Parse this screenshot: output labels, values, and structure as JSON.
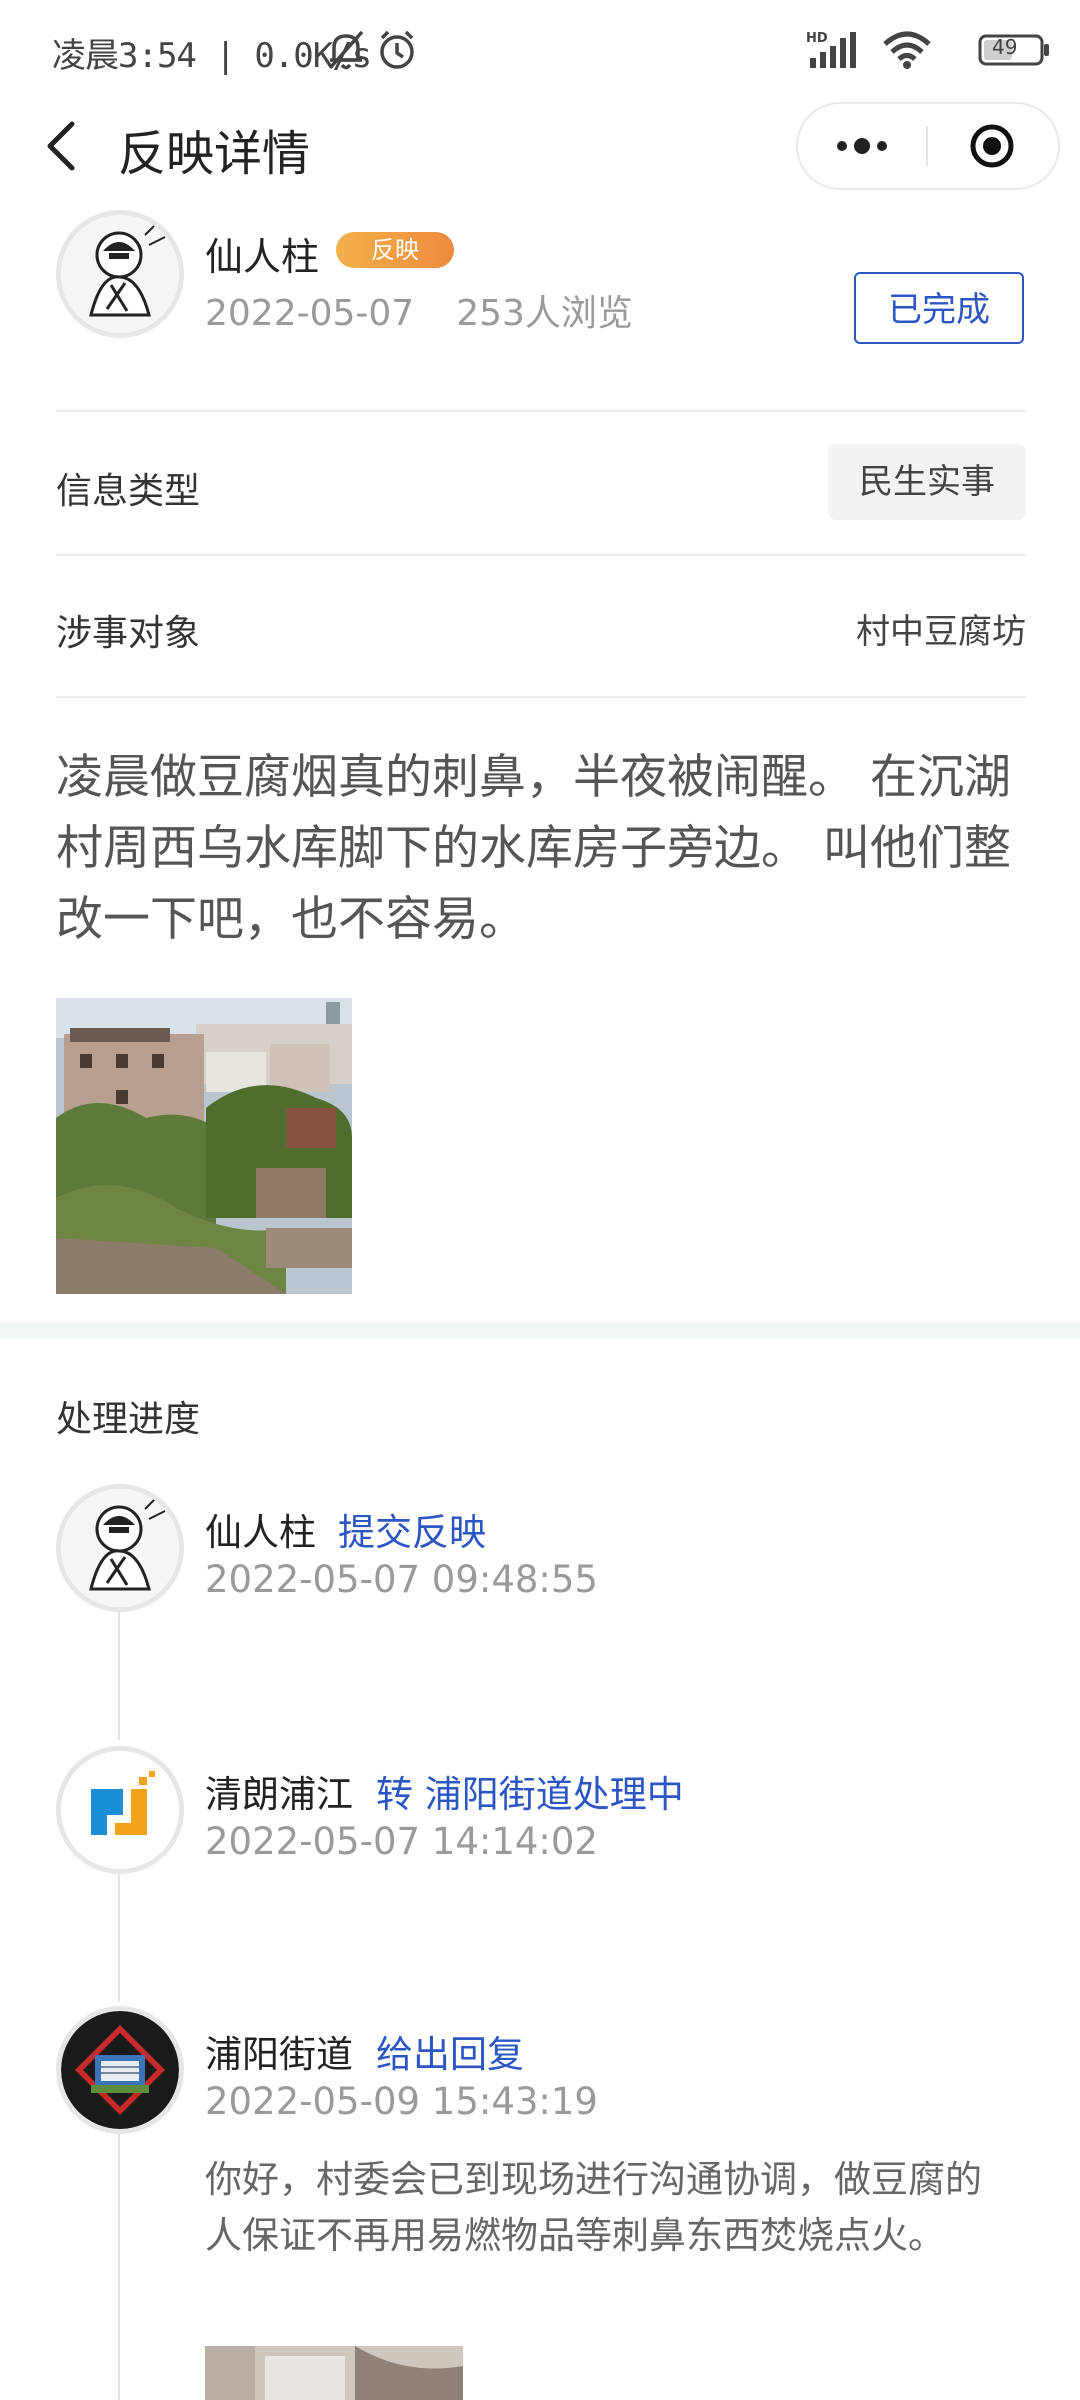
{
  "status_bar": {
    "time": "凌晨3:54",
    "speed": "0.0K/s",
    "battery": "49",
    "hd_label": "HD"
  },
  "titlebar": {
    "title": "反映详情"
  },
  "post": {
    "author": "仙人柱",
    "tag": "反映",
    "date": "2022-05-07",
    "views": "253人浏览",
    "status": "已完成",
    "info_type_label": "信息类型",
    "info_type_value": "民生实事",
    "subject_label": "涉事对象",
    "subject_value": "村中豆腐坊",
    "content": "凌晨做豆腐烟真的刺鼻，半夜被闹醒。 在沉湖村周西乌水库脚下的水库房子旁边。 叫他们整改一下吧，也不容易。"
  },
  "progress": {
    "title": "处理进度",
    "entries": [
      {
        "name": "仙人柱",
        "action": "提交反映",
        "time": "2022-05-07 09:48:55"
      },
      {
        "name": "清朗浦江",
        "action": "转 浦阳街道处理中",
        "time": "2022-05-07 14:14:02"
      },
      {
        "name": "浦阳街道",
        "action": "给出回复",
        "time": "2022-05-09 15:43:19",
        "reply": "你好，村委会已到现场进行沟通协调，做豆腐的人保证不再用易燃物品等刺鼻东西焚烧点火。"
      }
    ]
  },
  "colors": {
    "accent": "#2d56c5",
    "tag_start": "#f2b04a",
    "tag_end": "#ef8b3c",
    "muted": "#9a9a9a"
  },
  "icons": [
    "back-icon",
    "more-icon",
    "target-icon",
    "muted-bell-icon",
    "alarm-icon",
    "signal-icon",
    "wifi-icon",
    "battery-icon"
  ]
}
